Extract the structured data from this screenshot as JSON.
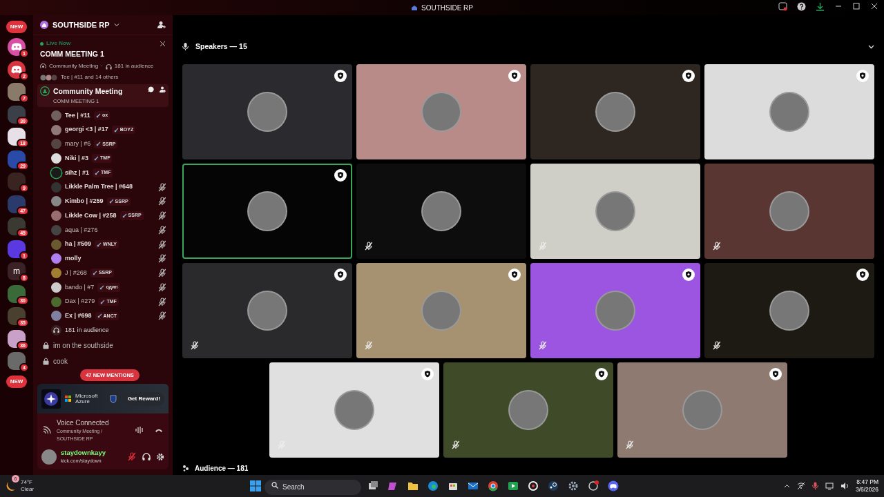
{
  "titlebar": {
    "title": "SOUTHSIDE RP"
  },
  "servers": [
    {
      "kind": "new",
      "label": "NEW"
    },
    {
      "kind": "discord",
      "color": "#d94fa6",
      "badge": "1"
    },
    {
      "kind": "discord",
      "color": "#d8343f",
      "badge": "2"
    },
    {
      "kind": "photo",
      "color": "#8a7a6a",
      "badge": "7"
    },
    {
      "kind": "photo",
      "color": "#3a3f48",
      "badge": "30"
    },
    {
      "kind": "photo",
      "color": "#e8e0e8",
      "badge": "18"
    },
    {
      "kind": "photo",
      "color": "#2a4aa8",
      "badge": "29"
    },
    {
      "kind": "photo",
      "color": "#3a2422",
      "badge": "9"
    },
    {
      "kind": "photo",
      "color": "#2a3a6a",
      "badge": "47"
    },
    {
      "kind": "photo",
      "color": "#3a3a32",
      "badge": "45"
    },
    {
      "kind": "photo",
      "color": "#5a3ae0",
      "badge": "1"
    },
    {
      "kind": "letter",
      "color": "#3a2226",
      "letter": "m",
      "badge": "8"
    },
    {
      "kind": "photo",
      "color": "#3a6a3a",
      "badge": "30"
    },
    {
      "kind": "photo",
      "color": "#4a4030",
      "badge": "35"
    },
    {
      "kind": "photo",
      "color": "#c8a0c8",
      "badge": "36"
    },
    {
      "kind": "photo",
      "color": "#6a6a6a",
      "badge": "4"
    },
    {
      "kind": "new",
      "label": "NEW"
    }
  ],
  "server_header": {
    "name": "SOUTHSIDE RP"
  },
  "live": {
    "status": "Live Now",
    "title": "COMM MEETING 1",
    "channel": "Community Meeting",
    "separator": "·",
    "audience": "181 in audience",
    "speakers": "Tee | #11 and 14 others"
  },
  "stage_channel": {
    "name": "Community Meeting",
    "topic": "COMM MEETING 1",
    "selected": true
  },
  "members": [
    {
      "name": "Tee | #11",
      "tag": "ox",
      "bold": true,
      "muted": false,
      "speaking": false
    },
    {
      "name": "georgi <3 | #17",
      "tag": "BOYZ",
      "bold": true,
      "muted": false,
      "speaking": false
    },
    {
      "name": "mary | #6",
      "tag": "SSRP",
      "bold": false,
      "muted": false,
      "speaking": false
    },
    {
      "name": "Niki | #3",
      "tag": "TMF",
      "bold": true,
      "muted": false,
      "speaking": false
    },
    {
      "name": "sihz | #1",
      "tag": "TMF",
      "bold": true,
      "muted": false,
      "speaking": true
    },
    {
      "name": "Likkle Palm Tree | #648",
      "bold": true,
      "muted": true,
      "speaking": false
    },
    {
      "name": "Kimbo | #259",
      "tag": "SSRP",
      "bold": true,
      "muted": true,
      "speaking": false
    },
    {
      "name": "Likkle Cow | #258",
      "tag": "SSRP",
      "bold": true,
      "muted": true,
      "speaking": false
    },
    {
      "name": "aqua | #276",
      "bold": false,
      "muted": true,
      "speaking": false
    },
    {
      "name": "ha | #509",
      "tag": "WNLY",
      "bold": true,
      "muted": true,
      "speaking": false
    },
    {
      "name": "molly",
      "bold": true,
      "muted": true,
      "speaking": false
    },
    {
      "name": "J | #268",
      "tag": "SSRP",
      "bold": false,
      "muted": true,
      "speaking": false
    },
    {
      "name": "bando | #7",
      "tag": "один",
      "bold": false,
      "muted": true,
      "speaking": false
    },
    {
      "name": "Dax | #279",
      "tag": "TMF",
      "bold": false,
      "muted": true,
      "speaking": false
    },
    {
      "name": "Ex | #698",
      "tag": "ANCT",
      "bold": true,
      "muted": true,
      "speaking": false
    }
  ],
  "audience_row": "181 in audience",
  "text_channels": [
    {
      "name": "im on the southside",
      "locked": true
    },
    {
      "name": "cook",
      "locked": true
    }
  ],
  "mentions_pill": "47 NEW MENTIONS",
  "promo": {
    "brand": "Microsoft Azure",
    "button": "Get Reward!"
  },
  "voice": {
    "status": "Voice Connected",
    "location": "Community Meeting / SOUTHSIDE RP"
  },
  "user": {
    "name": "staydownkayy",
    "custom_status": "kick.com/staydown",
    "mic_muted": true
  },
  "stage": {
    "speakers_header": "Speakers — 15",
    "audience_header": "Audience — 181",
    "tiles": [
      {
        "color": "#2b2a2e",
        "moderator": true,
        "muted": false,
        "speaking": false
      },
      {
        "color": "#b88b88",
        "moderator": true,
        "muted": false,
        "speaking": false
      },
      {
        "color": "#2e2620",
        "moderator": true,
        "muted": false,
        "speaking": false
      },
      {
        "color": "#dcdcdc",
        "moderator": true,
        "muted": false,
        "speaking": false
      },
      {
        "color": "#050505",
        "moderator": true,
        "muted": false,
        "speaking": true
      },
      {
        "color": "#0d0d0d",
        "moderator": false,
        "muted": true,
        "speaking": false
      },
      {
        "color": "#cfcfc8",
        "moderator": false,
        "muted": true,
        "speaking": false
      },
      {
        "color": "#5a3632",
        "moderator": false,
        "muted": true,
        "speaking": false
      },
      {
        "color": "#2a2a2c",
        "moderator": true,
        "muted": true,
        "speaking": false
      },
      {
        "color": "#a69170",
        "moderator": true,
        "muted": true,
        "speaking": false
      },
      {
        "color": "#9b55e0",
        "moderator": true,
        "muted": true,
        "speaking": false
      },
      {
        "color": "#1c1a12",
        "moderator": true,
        "muted": true,
        "speaking": false
      },
      {
        "color": "#e0e0e0",
        "moderator": true,
        "muted": true,
        "speaking": false
      },
      {
        "color": "#3e4a28",
        "moderator": true,
        "muted": true,
        "speaking": false
      },
      {
        "color": "#8e7a70",
        "moderator": true,
        "muted": true,
        "speaking": false
      }
    ]
  },
  "taskbar": {
    "weather_badge": "6",
    "temperature": "74°F",
    "weather": "Clear",
    "search": {
      "placeholder": "Search"
    },
    "time": "8:47 PM",
    "date": "3/6/2026"
  }
}
